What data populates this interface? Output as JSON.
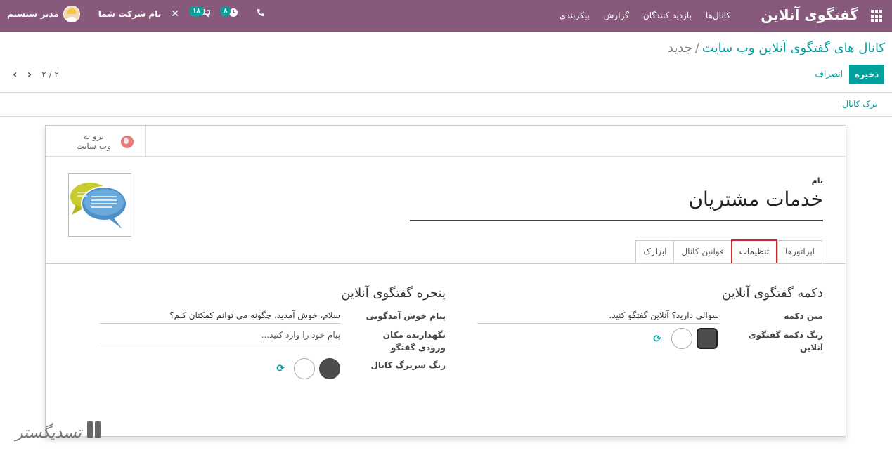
{
  "navbar": {
    "brand": "گفتگوی آنلاین",
    "menu": [
      "کانال‌ها",
      "بازدید کنندگان",
      "گزارش",
      "پیکربندی"
    ],
    "user": "مدیر سیستم",
    "company": "نام شرکت شما",
    "messages_badge": "۱۸",
    "activities_badge": "۸"
  },
  "control_panel": {
    "breadcrumb_parent": "کانال های گفتگوی آنلاین وب سایت",
    "breadcrumb_separator": "/",
    "breadcrumb_current": "جدید",
    "save_label": "ذخیره",
    "discard_label": "انصراف",
    "pager": "۲ / ۲"
  },
  "statusbar": {
    "leave_label": "ترک کانال"
  },
  "smart_button": {
    "line1": "برو به",
    "line2": "وب سایت"
  },
  "form": {
    "name_label": "نام",
    "name_value": "خدمات مشتریان",
    "tabs": [
      "اپراتورها",
      "تنظیمات",
      "قوانین کانال",
      "ابزارک"
    ],
    "active_tab": "تنظیمات",
    "button_section": {
      "title": "دکمه گفتگوی آنلاین",
      "text_label": "متن دکمه",
      "text_value": "سوالی دارید؟ آنلاین گفتگو کنید.",
      "color_label": "رنگ دکمه گفتگوی آنلاین"
    },
    "window_section": {
      "title": "پنجره گفتگوی آنلاین",
      "welcome_label": "پیام خوش آمدگویی",
      "welcome_value": "سلام، خوش آمدید، چگونه می توانم کمکتان کنم؟",
      "placeholder_label": "نگهدارنده مکان ورودی گفتگو",
      "placeholder_value": "پیام خود را وارد کنید...",
      "header_color_label": "رنگ سربرگ کانال"
    }
  },
  "colors": {
    "brand": "#875a7b",
    "accent": "#00a09d",
    "highlight": "#d9232d",
    "swatch_dark": "#4c4c4c"
  },
  "icons": [
    "apps-icon",
    "phone-icon",
    "clock-icon",
    "chat-icon",
    "tools-icon",
    "globe-icon",
    "refresh-icon",
    "chevron-left-icon",
    "chevron-right-icon"
  ],
  "watermark_text": "تسدیگستر"
}
